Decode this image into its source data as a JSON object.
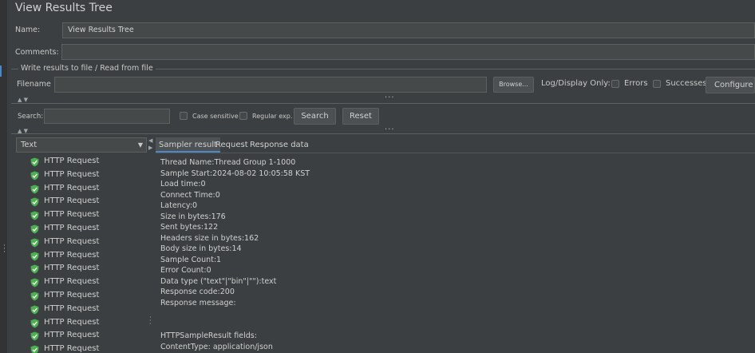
{
  "panel": {
    "title": "View Results Tree",
    "name_label": "Name:",
    "name_value": "View Results Tree",
    "comments_label": "Comments:",
    "comments_value": ""
  },
  "file_group": {
    "legend": "Write results to file / Read from file",
    "filename_label": "Filename",
    "filename_value": "",
    "browse_label": "Browse...",
    "log_display_label": "Log/Display Only:",
    "errors_label": "Errors",
    "successes_label": "Successes",
    "configure_label": "Configure"
  },
  "search_bar": {
    "search_label": "Search:",
    "search_value": "",
    "case_sensitive_label": "Case sensitive",
    "regular_exp_label": "Regular exp.",
    "search_button": "Search",
    "reset_button": "Reset"
  },
  "renderer": {
    "selected": "Text"
  },
  "tree": {
    "items": [
      "HTTP Request",
      "HTTP Request",
      "HTTP Request",
      "HTTP Request",
      "HTTP Request",
      "HTTP Request",
      "HTTP Request",
      "HTTP Request",
      "HTTP Request",
      "HTTP Request",
      "HTTP Request",
      "HTTP Request",
      "HTTP Request",
      "HTTP Request",
      "HTTP Request"
    ],
    "status_color": "#4caf50"
  },
  "tabs": [
    "Sampler result",
    "Request",
    "Response data"
  ],
  "sampler_result": {
    "lines_top": [
      "Thread Name:Thread Group 1-1000",
      "Sample Start:2024-08-02 10:05:58 KST",
      "Load time:0",
      "Connect Time:0",
      "Latency:0",
      "Size in bytes:176",
      "Sent bytes:122",
      "Headers size in bytes:162",
      "Body size in bytes:14",
      "Sample Count:1",
      "Error Count:0",
      "Data type (\"text\"|\"bin\"|\"\"):text",
      "Response code:200",
      "Response message:"
    ],
    "lines_bottom": [
      "HTTPSampleResult fields:",
      "ContentType: application/json"
    ]
  },
  "colors": {
    "background": "#3c3f41",
    "field": "#45494a",
    "accent": "#4a88c7"
  }
}
